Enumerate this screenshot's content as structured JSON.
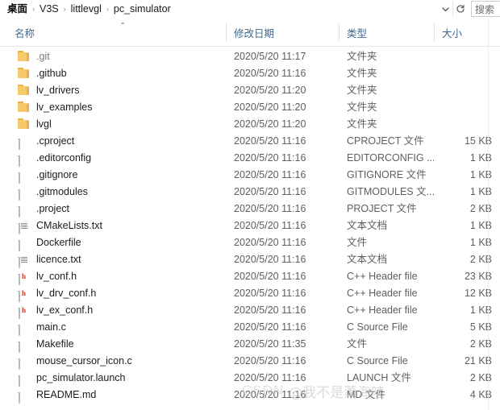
{
  "window": {
    "title": "pc_simulator"
  },
  "address_bar": {
    "breadcrumbs": [
      {
        "label": "桌面"
      },
      {
        "label": "V3S"
      },
      {
        "label": "littlevgl"
      },
      {
        "label": "pc_simulator"
      }
    ],
    "separator": "›",
    "history_dropdown_icon": "chevron-down-icon",
    "refresh_icon": "refresh-icon",
    "search_placeholder": "搜索"
  },
  "columns": {
    "sort_caret": "⌃",
    "headers": [
      {
        "key": "name",
        "label": "名称"
      },
      {
        "key": "date",
        "label": "修改日期"
      },
      {
        "key": "type",
        "label": "类型"
      },
      {
        "key": "size",
        "label": "大小"
      }
    ]
  },
  "files": [
    {
      "name": ".git",
      "date": "2020/5/20 11:17",
      "type": "文件夹",
      "size": "",
      "icon": "folder-icon",
      "dim": true
    },
    {
      "name": ".github",
      "date": "2020/5/20 11:16",
      "type": "文件夹",
      "size": "",
      "icon": "folder-icon",
      "dim": false
    },
    {
      "name": "lv_drivers",
      "date": "2020/5/20 11:20",
      "type": "文件夹",
      "size": "",
      "icon": "folder-icon",
      "dim": false
    },
    {
      "name": "lv_examples",
      "date": "2020/5/20 11:20",
      "type": "文件夹",
      "size": "",
      "icon": "folder-icon",
      "dim": false
    },
    {
      "name": "lvgl",
      "date": "2020/5/20 11:20",
      "type": "文件夹",
      "size": "",
      "icon": "folder-icon",
      "dim": false
    },
    {
      "name": ".cproject",
      "date": "2020/5/20 11:16",
      "type": "CPROJECT 文件",
      "size": "15 KB",
      "icon": "file-icon",
      "dim": false
    },
    {
      "name": ".editorconfig",
      "date": "2020/5/20 11:16",
      "type": "EDITORCONFIG ...",
      "size": "1 KB",
      "icon": "file-icon",
      "dim": false
    },
    {
      "name": ".gitignore",
      "date": "2020/5/20 11:16",
      "type": "GITIGNORE 文件",
      "size": "1 KB",
      "icon": "file-icon",
      "dim": false
    },
    {
      "name": ".gitmodules",
      "date": "2020/5/20 11:16",
      "type": "GITMODULES 文...",
      "size": "1 KB",
      "icon": "file-icon",
      "dim": false
    },
    {
      "name": ".project",
      "date": "2020/5/20 11:16",
      "type": "PROJECT 文件",
      "size": "2 KB",
      "icon": "file-icon",
      "dim": false
    },
    {
      "name": "CMakeLists.txt",
      "date": "2020/5/20 11:16",
      "type": "文本文档",
      "size": "1 KB",
      "icon": "text-file-icon",
      "dim": false
    },
    {
      "name": "Dockerfile",
      "date": "2020/5/20 11:16",
      "type": "文件",
      "size": "1 KB",
      "icon": "file-icon",
      "dim": false
    },
    {
      "name": "licence.txt",
      "date": "2020/5/20 11:16",
      "type": "文本文档",
      "size": "2 KB",
      "icon": "text-file-icon",
      "dim": false
    },
    {
      "name": "lv_conf.h",
      "date": "2020/5/20 11:16",
      "type": "C++ Header file",
      "size": "23 KB",
      "icon": "header-file-icon",
      "dim": false
    },
    {
      "name": "lv_drv_conf.h",
      "date": "2020/5/20 11:16",
      "type": "C++ Header file",
      "size": "12 KB",
      "icon": "header-file-icon",
      "dim": false
    },
    {
      "name": "lv_ex_conf.h",
      "date": "2020/5/20 11:16",
      "type": "C++ Header file",
      "size": "1 KB",
      "icon": "header-file-icon",
      "dim": false
    },
    {
      "name": "main.c",
      "date": "2020/5/20 11:16",
      "type": "C Source File",
      "size": "5 KB",
      "icon": "file-icon",
      "dim": false
    },
    {
      "name": "Makefile",
      "date": "2020/5/20 11:35",
      "type": "文件",
      "size": "2 KB",
      "icon": "file-icon",
      "dim": false
    },
    {
      "name": "mouse_cursor_icon.c",
      "date": "2020/5/20 11:16",
      "type": "C Source File",
      "size": "21 KB",
      "icon": "file-icon",
      "dim": false
    },
    {
      "name": "pc_simulator.launch",
      "date": "2020/5/20 11:16",
      "type": "LAUNCH 文件",
      "size": "2 KB",
      "icon": "file-icon",
      "dim": false
    },
    {
      "name": "README.md",
      "date": "2020/5/20 11:16",
      "type": "MD 文件",
      "size": "4 KB",
      "icon": "file-icon",
      "dim": false
    }
  ],
  "watermark": {
    "site": "CSDN",
    "user": "@我不是萧海哇"
  },
  "colors": {
    "folder": "#f7c96b",
    "header_text": "#41698f",
    "body_text": "#1c1c1c",
    "secondary_text": "#5e5e5e",
    "header_letter": "#c0392b"
  }
}
